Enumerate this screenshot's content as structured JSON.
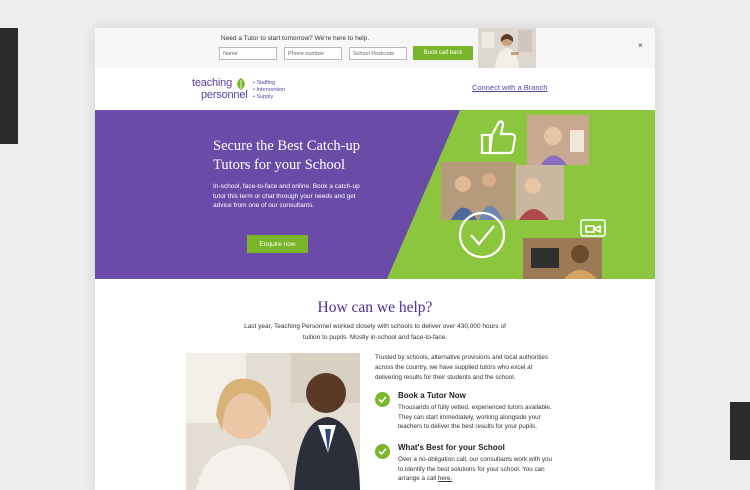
{
  "topbar": {
    "prompt": "Need a Tutor to start tomorrow?   We're here to help.",
    "name_placeholder": "Name",
    "phone_placeholder": "Phone number",
    "postcode_placeholder": "School Postcode",
    "button": "Book call back",
    "close": "×"
  },
  "header": {
    "logo_line1": "teaching",
    "logo_line2": "personnel",
    "logo_tags": [
      "• Staffing",
      "• Intervention",
      "• Supply"
    ],
    "branch_link": "Connect with a Branch"
  },
  "hero": {
    "title": "Secure the Best Catch-up Tutors for your School",
    "body": "In-school, face-to-face and online. Book a catch-up tutor this term or chat through your needs and get advice from one of our consultants.",
    "button": "Enquire now"
  },
  "help": {
    "title": "How can we help?",
    "intro": "Last year, Teaching Personnel worked closely with schools to deliver over 430,000 hours of tuition to pupils. Mostly in-school and face-to-face.",
    "para": "Trusted by schools, alternative provisions and local authorities across the country, we have supplied tutors who excel at delivering results for their students and the school.",
    "features": [
      {
        "title": "Book a Tutor Now",
        "body": "Thousands of fully vetted, experienced tutors available. They can start immediately, working alongside your teachers to deliver the best results for your pupils."
      },
      {
        "title": "What's Best for your School",
        "body": "Over a no-obligation call, our consultants work with you to identify the best solutions for your school. You can arrange a call",
        "link": "here."
      }
    ]
  },
  "colors": {
    "brand_purple": "#6a4ba8",
    "brand_green": "#7bb52a",
    "heading_purple": "#4c2f93"
  },
  "icons": [
    "thumbs-up-icon",
    "checkmark-circle-icon",
    "video-call-icon",
    "check-icon",
    "close-icon",
    "leaf-icon"
  ]
}
